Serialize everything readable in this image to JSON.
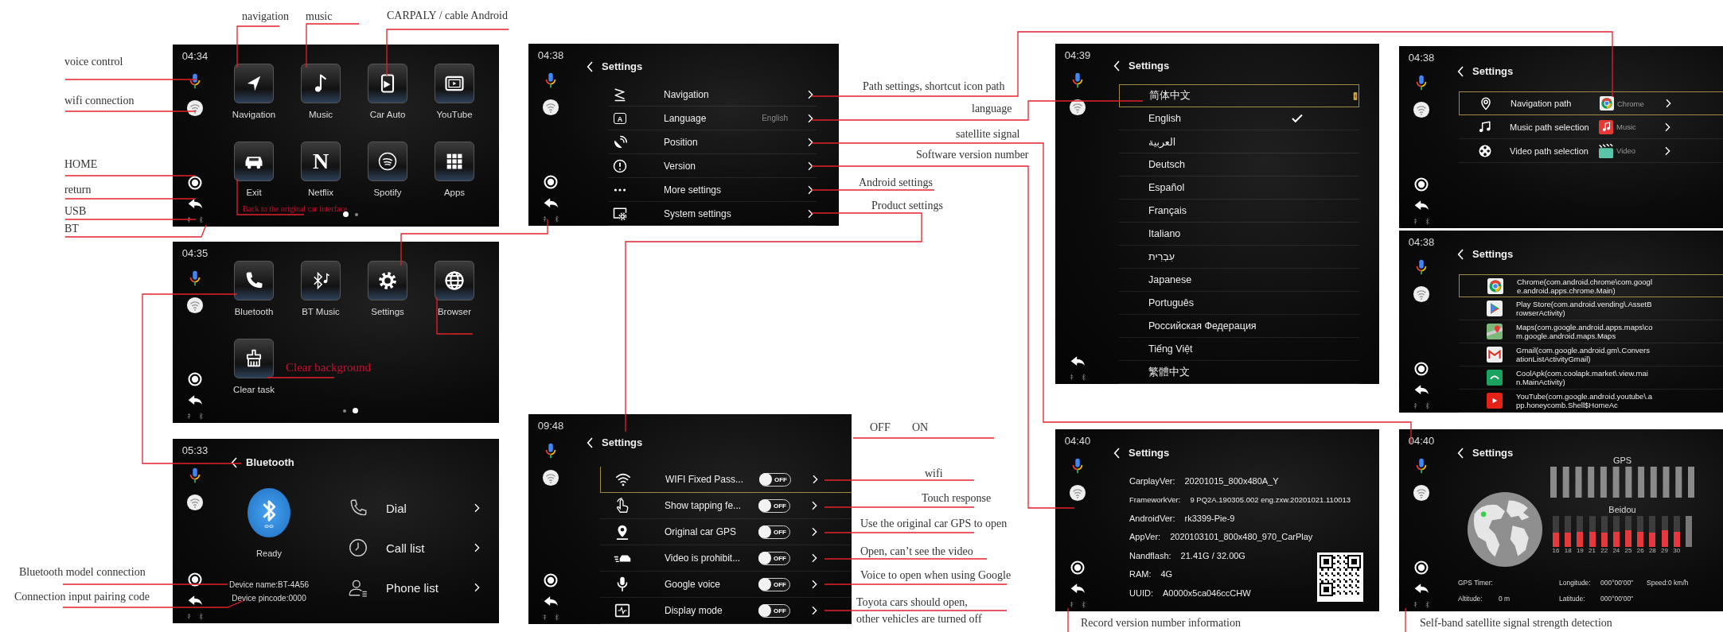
{
  "screens": [
    {
      "kind": "home",
      "time": "04:34",
      "apps": [
        {
          "label": "Navigation"
        },
        {
          "label": "Music"
        },
        {
          "label": "Car Auto"
        },
        {
          "label": "YouTube"
        },
        {
          "label": "Exit"
        },
        {
          "label": "Netflix",
          "glyph": "N"
        },
        {
          "label": "Spotify"
        },
        {
          "label": "Apps"
        }
      ],
      "dots": [
        {
          "selected": true
        },
        {
          "selected": false
        }
      ]
    },
    {
      "kind": "home",
      "time": "04:35",
      "apps": [
        {
          "label": "Bluetooth"
        },
        {
          "label": "BT Music"
        },
        {
          "label": "Settings"
        },
        {
          "label": "Browser"
        },
        {
          "label": "Clear task"
        }
      ],
      "dots": [
        {
          "selected": false
        },
        {
          "selected": true
        }
      ]
    },
    {
      "kind": "bluetooth",
      "time": "05:33",
      "title": "Bluetooth",
      "status": "Ready",
      "device_name": "Device name:BT-4A56",
      "pincode": "Device pincode:0000",
      "menu": [
        {
          "label": "Dial"
        },
        {
          "label": "Call list"
        },
        {
          "label": "Phone list"
        }
      ]
    },
    {
      "kind": "settings_menu",
      "time": "04:38",
      "title": "Settings",
      "items": [
        {
          "label": "Navigation"
        },
        {
          "label": "Language",
          "glyph": "A",
          "value": "English"
        },
        {
          "label": "Position"
        },
        {
          "label": "Version"
        },
        {
          "label": "More settings"
        },
        {
          "label": "System settings"
        }
      ]
    },
    {
      "kind": "toggles",
      "time": "09:48",
      "title": "Settings",
      "items": [
        {
          "label": "WIFI Fixed Pass...",
          "toggle_text": "OFF",
          "on": false,
          "selected": true
        },
        {
          "label": "Show tapping fe...",
          "toggle_text": "OFF",
          "on": false,
          "selected": false
        },
        {
          "label": "Original car GPS",
          "toggle_text": "OFF",
          "on": false,
          "selected": false
        },
        {
          "label": "Video is prohibit...",
          "toggle_text": "OFF",
          "on": false,
          "selected": false
        },
        {
          "label": "Google voice",
          "toggle_text": "OFF",
          "on": false,
          "selected": false
        },
        {
          "label": "Display mode",
          "toggle_text": "OFF",
          "on": false,
          "selected": false
        }
      ]
    },
    {
      "kind": "languages",
      "time": "04:39",
      "title": "Settings",
      "items": [
        {
          "label": "简体中文",
          "selected": true,
          "checked": false
        },
        {
          "label": "English",
          "selected": false,
          "checked": true
        },
        {
          "label": "العربية",
          "selected": false,
          "checked": false
        },
        {
          "label": "Deutsch",
          "selected": false,
          "checked": false
        },
        {
          "label": "Español",
          "selected": false,
          "checked": false
        },
        {
          "label": "Français",
          "selected": false,
          "checked": false
        },
        {
          "label": "Italiano",
          "selected": false,
          "checked": false
        },
        {
          "label": "עִבְרִית",
          "selected": false,
          "checked": false
        },
        {
          "label": "Japanese",
          "selected": false,
          "checked": false
        },
        {
          "label": "Português",
          "selected": false,
          "checked": false
        },
        {
          "label": "Российская Федерация",
          "selected": false,
          "checked": false
        },
        {
          "label": "Tiếng Việt",
          "selected": false,
          "checked": false
        },
        {
          "label": "繁體中文",
          "selected": false,
          "checked": false
        }
      ]
    },
    {
      "kind": "paths",
      "time": "04:38",
      "title": "Settings",
      "items": [
        {
          "label": "Navigation path",
          "app": "Chrome",
          "selected": true
        },
        {
          "label": "Music path selection",
          "app": "Music",
          "selected": false
        },
        {
          "label": "Video path selection",
          "app": "Video",
          "selected": false
        }
      ]
    },
    {
      "kind": "apps",
      "time": "04:38",
      "title": "Settings",
      "items": [
        {
          "label": "Chrome(com.android.chrome\\com.google.android.apps.chrome.Main)",
          "selected": true
        },
        {
          "label": "Play Store(com.android.vending\\.AssetBrowserActivity)",
          "selected": false
        },
        {
          "label": "Maps(com.google.android.apps.maps\\com.google.android.maps.Maps",
          "selected": false
        },
        {
          "label": "Gmail(com.google.android.gm\\.ConversationListActivityGmail)",
          "selected": false
        },
        {
          "label": "CoolApk(com.coolapk.market\\.view.main.MainActivity)",
          "selected": false
        },
        {
          "label": "YouTube(com.google.android.youtube\\.app.honeycomb.Shell$HomeAc",
          "selected": false
        }
      ]
    },
    {
      "kind": "version",
      "time": "04:40",
      "title": "Settings",
      "rows": [
        {
          "label": "CarplayVer:",
          "value": "20201015_800x480A_Y"
        },
        {
          "label": "FrameworkVer:",
          "value": "9 PQ2A.190305.002 eng.zxw.20201021.110013"
        },
        {
          "label": "AndroidVer:",
          "value": "rk3399-Pie-9"
        },
        {
          "label": "AppVer:",
          "value": "2020103101_800x480_970_CarPlay"
        },
        {
          "label": "Nandflash:",
          "value": "21.41G / 32.00G"
        },
        {
          "label": "RAM:",
          "value": "4G"
        },
        {
          "label": "UUID:",
          "value": "A0000x5ca046ccCHW"
        }
      ]
    },
    {
      "kind": "gps",
      "time": "04:40",
      "title": "Settings",
      "gps_label": "GPS",
      "beidou_label": "Beidou",
      "beidou_bars": [
        {
          "label": "16",
          "level": 0.45
        },
        {
          "label": "18",
          "level": 0.45
        },
        {
          "label": "19",
          "level": 0.5
        },
        {
          "label": "21",
          "level": 0.5
        },
        {
          "label": "22",
          "level": 0.45
        },
        {
          "label": "24",
          "level": 0.5
        },
        {
          "label": "25",
          "level": 0.55
        },
        {
          "label": "26",
          "level": 0.5
        },
        {
          "label": "28",
          "level": 0.45
        },
        {
          "label": "29",
          "level": 0.55
        },
        {
          "label": "30",
          "level": 0.5
        }
      ],
      "fields": [
        {
          "label": "GPS Timer:"
        },
        {
          "label": "Longitude:",
          "value": "000°00'00\""
        },
        {
          "label": "Speed:",
          "value": "0 km/h"
        },
        {
          "label": "Altitude:",
          "value": "0 m"
        },
        {
          "label": "Latitude:",
          "value": "000°00'00\""
        }
      ]
    }
  ],
  "annotations": [
    {
      "text": "navigation",
      "kind": "callout"
    },
    {
      "text": "music",
      "kind": "callout"
    },
    {
      "text": "CARPALY / cable Android",
      "kind": "callout"
    },
    {
      "text": "voice control",
      "kind": "callout"
    },
    {
      "text": "wifi connection",
      "kind": "callout"
    },
    {
      "text": "HOME",
      "kind": "callout"
    },
    {
      "text": "return",
      "kind": "callout"
    },
    {
      "text": "USB",
      "kind": "callout"
    },
    {
      "text": "BT",
      "kind": "callout"
    },
    {
      "text": "Back to the original car interface",
      "kind": "inset"
    },
    {
      "text": "Clear background",
      "kind": "inset"
    },
    {
      "text": "Bluetooth model connection",
      "kind": "callout"
    },
    {
      "text": "Connection input pairing code",
      "kind": "callout"
    },
    {
      "text": "Path settings, shortcut icon path",
      "kind": "callout"
    },
    {
      "text": "language",
      "kind": "callout"
    },
    {
      "text": "satellite signal",
      "kind": "callout"
    },
    {
      "text": "Software version number",
      "kind": "callout"
    },
    {
      "text": "Android settings",
      "kind": "callout"
    },
    {
      "text": "Product settings",
      "kind": "callout"
    },
    {
      "text": "OFF",
      "kind": "callout"
    },
    {
      "text": "ON",
      "kind": "callout"
    },
    {
      "text": "wifi",
      "kind": "callout"
    },
    {
      "text": "Touch response",
      "kind": "callout"
    },
    {
      "text": "Use the original car GPS to open",
      "kind": "callout"
    },
    {
      "text": "Open, can’t see the video",
      "kind": "callout"
    },
    {
      "text": "Voice to open when using Google",
      "kind": "callout"
    },
    {
      "text": "Toyota cars should open,",
      "kind": "callout"
    },
    {
      "text": "other vehicles are turned off",
      "kind": "callout"
    },
    {
      "text": "Record version number information",
      "kind": "callout"
    },
    {
      "text": "Self-band satellite signal strength detection",
      "kind": "callout"
    }
  ]
}
